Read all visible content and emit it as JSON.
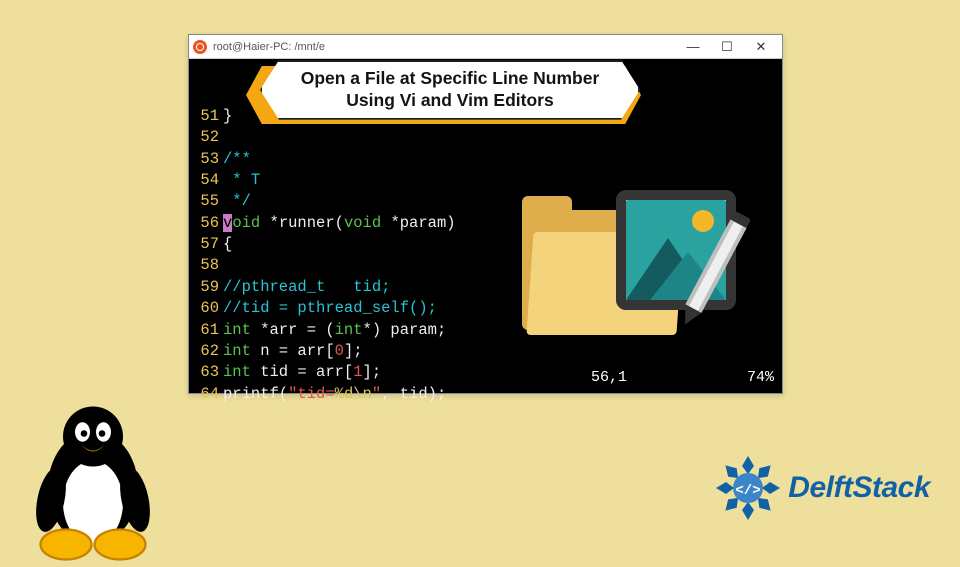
{
  "window": {
    "title": "root@Haier-PC: /mnt/e",
    "controls": {
      "min": "—",
      "max": "☐",
      "close": "✕"
    }
  },
  "callout": {
    "line1": "Open a File at Specific Line Number",
    "line2": "Using Vi and Vim Editors"
  },
  "code": {
    "lines": [
      {
        "num": "51",
        "segments": [
          {
            "cls": "c-white",
            "t": "}"
          }
        ]
      },
      {
        "num": "52",
        "segments": []
      },
      {
        "num": "53",
        "segments": [
          {
            "cls": "c-cyan",
            "t": "/**"
          }
        ]
      },
      {
        "num": "54",
        "segments": [
          {
            "cls": "c-cyan",
            "t": " * T"
          }
        ]
      },
      {
        "num": "55",
        "segments": [
          {
            "cls": "c-cyan",
            "t": " */"
          }
        ]
      },
      {
        "num": "56",
        "segments": [
          {
            "cls": "cursor-hl",
            "t": "v"
          },
          {
            "cls": "c-green",
            "t": "oid"
          },
          {
            "cls": "c-white",
            "t": " *runner("
          },
          {
            "cls": "c-green",
            "t": "void"
          },
          {
            "cls": "c-white",
            "t": " *param)"
          }
        ]
      },
      {
        "num": "57",
        "segments": [
          {
            "cls": "c-white",
            "t": "{"
          }
        ]
      },
      {
        "num": "58",
        "segments": []
      },
      {
        "num": "59",
        "segments": [
          {
            "cls": "c-cyan",
            "t": "//pthread_t   tid;"
          }
        ]
      },
      {
        "num": "60",
        "segments": [
          {
            "cls": "c-cyan",
            "t": "//tid = pthread_self();"
          }
        ]
      },
      {
        "num": "61",
        "segments": [
          {
            "cls": "c-green",
            "t": "int"
          },
          {
            "cls": "c-white",
            "t": " *arr = ("
          },
          {
            "cls": "c-green",
            "t": "int"
          },
          {
            "cls": "c-white",
            "t": "*) param;"
          }
        ]
      },
      {
        "num": "62",
        "segments": [
          {
            "cls": "c-green",
            "t": "int"
          },
          {
            "cls": "c-white",
            "t": " n = arr["
          },
          {
            "cls": "c-red",
            "t": "0"
          },
          {
            "cls": "c-white",
            "t": "];"
          }
        ]
      },
      {
        "num": "63",
        "segments": [
          {
            "cls": "c-green",
            "t": "int"
          },
          {
            "cls": "c-white",
            "t": " tid = arr["
          },
          {
            "cls": "c-red",
            "t": "1"
          },
          {
            "cls": "c-white",
            "t": "];"
          }
        ]
      },
      {
        "num": "64",
        "segments": [
          {
            "cls": "c-white",
            "t": "printf("
          },
          {
            "cls": "c-red",
            "t": "\"tid="
          },
          {
            "cls": "c-yellow",
            "t": "%d\\n"
          },
          {
            "cls": "c-red",
            "t": "\""
          },
          {
            "cls": "c-white",
            "t": ", tid);"
          }
        ]
      }
    ]
  },
  "status": {
    "pos": "56,1",
    "pct": "74%"
  },
  "brand": {
    "name": "DelftStack"
  }
}
